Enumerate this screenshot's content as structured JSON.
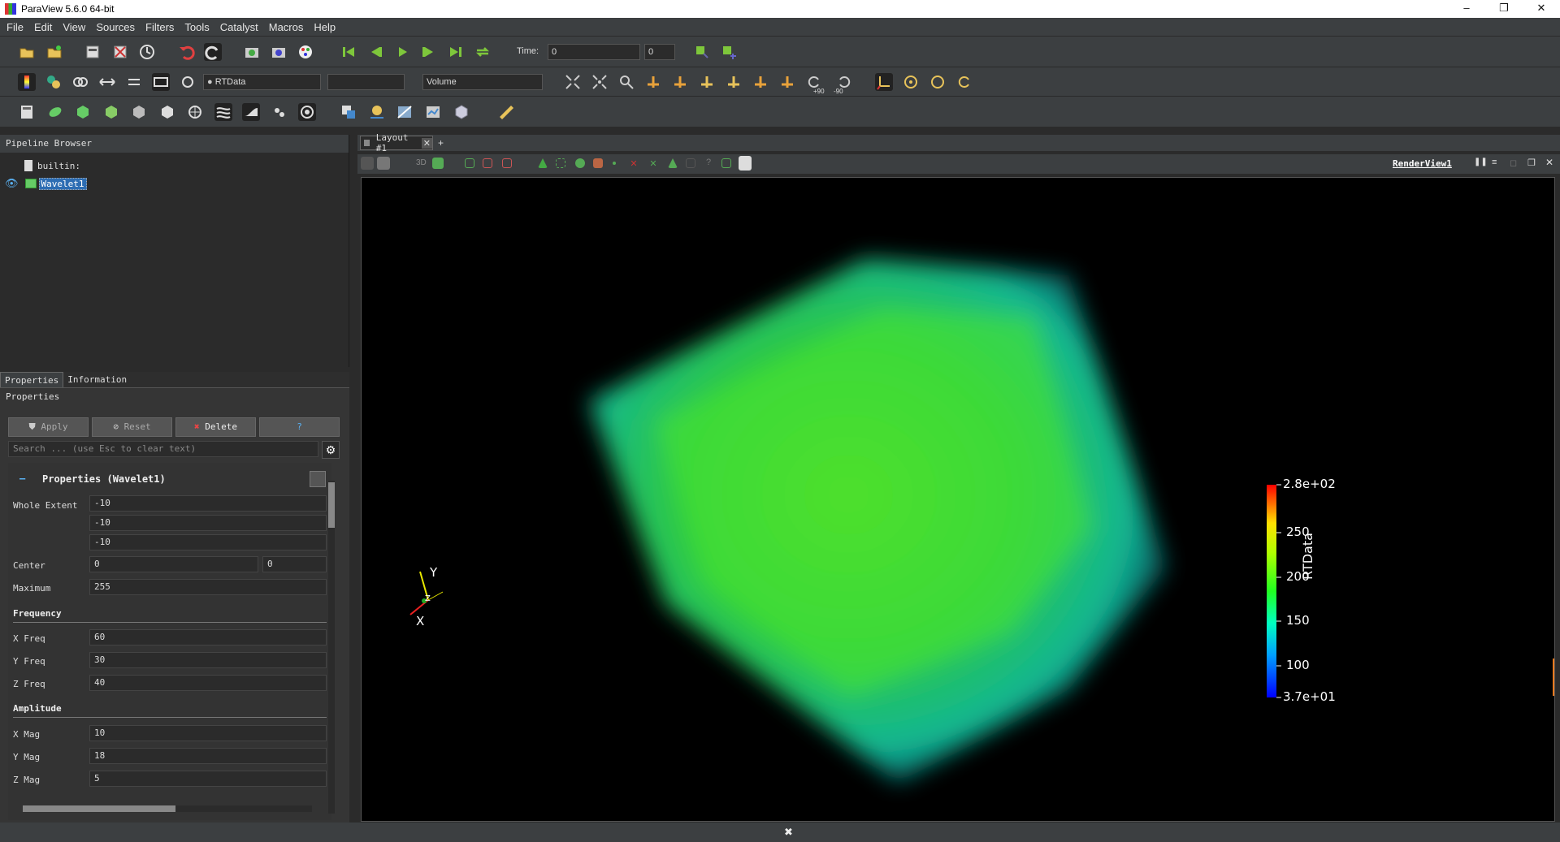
{
  "window": {
    "title": "ParaView 5.6.0 64-bit",
    "minimize": "–",
    "maximize": "❐",
    "close": "✕"
  },
  "menu": [
    "File",
    "Edit",
    "View",
    "Sources",
    "Filters",
    "Tools",
    "Catalyst",
    "Macros",
    "Help"
  ],
  "toolbar": {
    "time_label": "Time:",
    "time_value": "0",
    "timestep_value": "0",
    "color_array": "RTData",
    "representation": "Volume",
    "rot_plus90": "+90",
    "rot_minus90": "-90"
  },
  "pipeline": {
    "title": "Pipeline Browser",
    "items": [
      {
        "label": "builtin:"
      },
      {
        "label": "Wavelet1"
      }
    ]
  },
  "properties": {
    "tabs": [
      "Properties",
      "Information"
    ],
    "header": "Properties",
    "buttons": {
      "apply": "Apply",
      "reset": "Reset",
      "delete": "Delete",
      "help": "?"
    },
    "search_placeholder": "Search ... (use Esc to clear text)",
    "section_title": "Properties (Wavelet1)",
    "whole_extent_label": "Whole Extent",
    "whole_extent": [
      "-10",
      "-10",
      "-10"
    ],
    "center_label": "Center",
    "center": [
      "0",
      "0"
    ],
    "maximum_label": "Maximum",
    "maximum": "255",
    "frequency_label": "Frequency",
    "x_freq_label": "X Freq",
    "x_freq": "60",
    "y_freq_label": "Y Freq",
    "y_freq": "30",
    "z_freq_label": "Z Freq",
    "z_freq": "40",
    "amplitude_label": "Amplitude",
    "x_mag_label": "X Mag",
    "x_mag": "10",
    "y_mag_label": "Y Mag",
    "y_mag": "18",
    "z_mag_label": "Z Mag",
    "z_mag": "5"
  },
  "layout": {
    "tab_label": "Layout #1",
    "add_tab": "+",
    "view_mode": "3D",
    "render_view_name": "RenderView1"
  },
  "colorbar": {
    "title": "RTData",
    "max_label": "2.8e+02",
    "min_label": "3.7e+01",
    "ticks": [
      "250",
      "200",
      "150",
      "100"
    ]
  },
  "axes": {
    "x": "X",
    "y": "Y",
    "z": "Z"
  },
  "status": {
    "close": "✖"
  }
}
